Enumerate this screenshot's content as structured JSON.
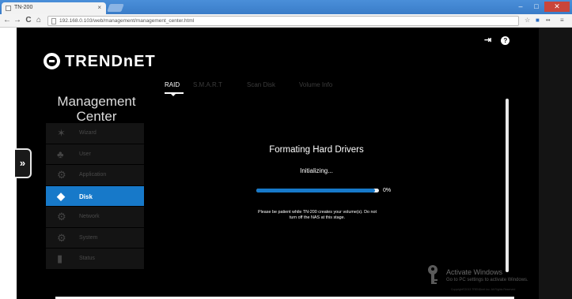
{
  "browser": {
    "tab_title": "TN-200",
    "tab_close": "×",
    "url": "192.168.0.103/web/management/management_center.html",
    "nav_back": "←",
    "nav_forward": "→",
    "nav_reload": "C",
    "nav_home": "⌂",
    "win_min": "–",
    "win_max": "□",
    "win_close": "✕"
  },
  "header": {
    "logo_text": "TRENDnET",
    "logout_icon": "⇥"
  },
  "sidebar": {
    "expand_label": "»",
    "title_line1": "Management",
    "title_line2": "Center",
    "items": [
      {
        "label": "Wizard",
        "icon": "wand-icon",
        "glyph": "✶",
        "active": false
      },
      {
        "label": "User",
        "icon": "user-icon",
        "glyph": "♣",
        "active": false
      },
      {
        "label": "Application",
        "icon": "gear-icon",
        "glyph": "⚙",
        "active": false
      },
      {
        "label": "Disk",
        "icon": "disk-icon",
        "glyph": "◆",
        "active": true
      },
      {
        "label": "Network",
        "icon": "network-icon",
        "glyph": "⚙",
        "active": false
      },
      {
        "label": "System",
        "icon": "system-icon",
        "glyph": "⚙",
        "active": false
      },
      {
        "label": "Status",
        "icon": "status-icon",
        "glyph": "▮",
        "active": false
      }
    ]
  },
  "tabs": [
    {
      "label": "RAID",
      "active": true
    },
    {
      "label": "S.M.A.R.T",
      "active": false
    },
    {
      "label": "Scan Disk",
      "active": false
    },
    {
      "label": "Volume Info",
      "active": false
    }
  ],
  "main": {
    "heading": "Formating Hard Drivers",
    "status": "Initializing...",
    "progress_fraction": 0.97,
    "progress_label": "0%",
    "note": "Please be patient while TN-200 creates your volume(s). Do not turn off the NAS at this stage."
  },
  "watermark": {
    "title": "Activate Windows",
    "subtitle": "Go to PC settings to activate Windows.",
    "copyright": "Copyright©2013 TRENDnet Inc. All Rights Reserved"
  },
  "colors": {
    "accent": "#1779c9",
    "background": "#000000",
    "titlebar": "#3a7cc8"
  }
}
